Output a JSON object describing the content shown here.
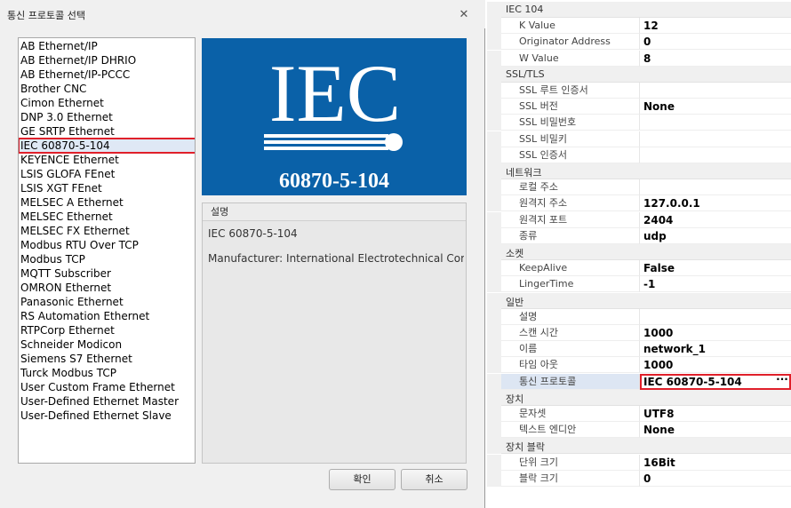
{
  "dialog": {
    "title": "통신 프로토콜 선택",
    "protocols": [
      "AB Ethernet/IP",
      "AB Ethernet/IP DHRIO",
      "AB Ethernet/IP-PCCC",
      "Brother CNC",
      "Cimon Ethernet",
      "DNP 3.0 Ethernet",
      "GE SRTP Ethernet",
      "IEC 60870-5-104",
      "KEYENCE Ethernet",
      "LSIS GLOFA FEnet",
      "LSIS XGT FEnet",
      "MELSEC A Ethernet",
      "MELSEC Ethernet",
      "MELSEC FX Ethernet",
      "Modbus RTU Over TCP",
      "Modbus TCP",
      "MQTT Subscriber",
      "OMRON Ethernet",
      "Panasonic Ethernet",
      "RS Automation Ethernet",
      "RTPCorp Ethernet",
      "Schneider Modicon",
      "Siemens S7 Ethernet",
      "Turck Modbus TCP",
      "User Custom Frame Ethernet",
      "User-Defined Ethernet Master",
      "User-Defined Ethernet Slave"
    ],
    "selected_index": 7,
    "logo": {
      "top": "IEC",
      "bottom": "60870-5-104",
      "bg_color": "#0a61a8"
    },
    "description": {
      "header": "설명",
      "line1": "IEC 60870-5-104",
      "line2": "Manufacturer: International Electrotechnical Com..."
    },
    "ok_label": "확인",
    "cancel_label": "취소"
  },
  "property_grid": {
    "rows": [
      {
        "kind": "category",
        "label": "IEC 104"
      },
      {
        "kind": "prop",
        "name": "K Value",
        "value": "12"
      },
      {
        "kind": "prop",
        "name": "Originator Address",
        "value": "0"
      },
      {
        "kind": "prop",
        "name": "W Value",
        "value": "8"
      },
      {
        "kind": "category",
        "label": "SSL/TLS"
      },
      {
        "kind": "prop",
        "name": "SSL 루트 인증서",
        "value": ""
      },
      {
        "kind": "prop",
        "name": "SSL 버전",
        "value": "None"
      },
      {
        "kind": "prop",
        "name": "SSL 비밀번호",
        "value": ""
      },
      {
        "kind": "prop",
        "name": "SSL 비밀키",
        "value": ""
      },
      {
        "kind": "prop",
        "name": "SSL 인증서",
        "value": ""
      },
      {
        "kind": "category",
        "label": "네트워크"
      },
      {
        "kind": "prop",
        "name": "로컬 주소",
        "value": ""
      },
      {
        "kind": "prop",
        "name": "원격지 주소",
        "value": "127.0.0.1"
      },
      {
        "kind": "prop",
        "name": "원격지 포트",
        "value": "2404"
      },
      {
        "kind": "prop",
        "name": "종류",
        "value": "udp"
      },
      {
        "kind": "category",
        "label": "소켓"
      },
      {
        "kind": "prop",
        "name": "KeepAlive",
        "value": "False"
      },
      {
        "kind": "prop",
        "name": "LingerTime",
        "value": "-1"
      },
      {
        "kind": "category",
        "label": "일반"
      },
      {
        "kind": "prop",
        "name": "설명",
        "value": ""
      },
      {
        "kind": "prop",
        "name": "스캔 시간",
        "value": "1000"
      },
      {
        "kind": "prop",
        "name": "이름",
        "value": "network_1"
      },
      {
        "kind": "prop",
        "name": "타임 아웃",
        "value": "1000"
      },
      {
        "kind": "prop",
        "name": "통신 프로토콜",
        "value": "IEC 60870-5-104",
        "selected": true,
        "has_button": true
      },
      {
        "kind": "category",
        "label": "장치"
      },
      {
        "kind": "prop",
        "name": "문자셋",
        "value": "UTF8"
      },
      {
        "kind": "prop",
        "name": "텍스트 엔디안",
        "value": "None"
      },
      {
        "kind": "category",
        "label": "장치 블락"
      },
      {
        "kind": "prop",
        "name": "단위 크기",
        "value": "16Bit"
      },
      {
        "kind": "prop",
        "name": "블락 크기",
        "value": "0"
      }
    ],
    "ellipsis_label": "···"
  }
}
